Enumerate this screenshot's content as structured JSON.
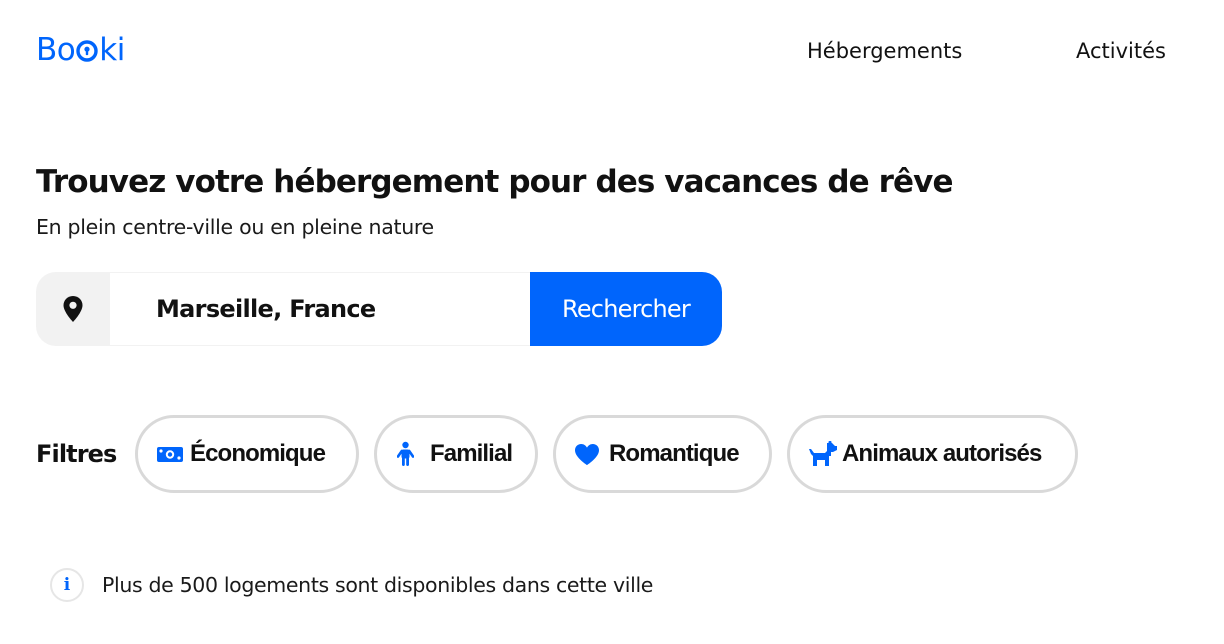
{
  "brand": {
    "logo_parts": [
      "B",
      "o",
      "ki"
    ],
    "accent_color": "#0065fc"
  },
  "nav": {
    "items": [
      {
        "label": "Hébergements"
      },
      {
        "label": "Activités"
      }
    ]
  },
  "hero": {
    "title": "Trouvez votre hébergement pour des vacances de rêve",
    "subtitle": "En plein centre-ville ou en pleine nature"
  },
  "search": {
    "value": "Marseille, France",
    "button_label": "Rechercher",
    "pin_icon": "map-pin-icon"
  },
  "filters": {
    "label": "Filtres",
    "items": [
      {
        "label": "Économique",
        "icon": "money-bill-icon"
      },
      {
        "label": "Familial",
        "icon": "child-icon"
      },
      {
        "label": "Romantique",
        "icon": "heart-icon"
      },
      {
        "label": "Animaux autorisés",
        "icon": "dog-icon"
      }
    ]
  },
  "info": {
    "icon_letter": "i",
    "text": "Plus de 500 logements sont disponibles dans cette ville"
  }
}
